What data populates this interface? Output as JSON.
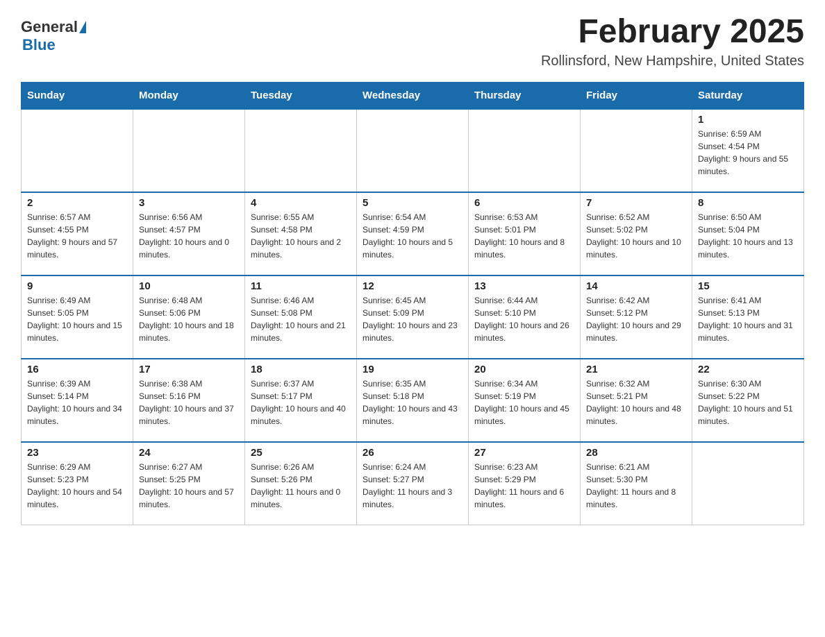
{
  "logo": {
    "general": "General",
    "blue": "Blue"
  },
  "title": "February 2025",
  "location": "Rollinsford, New Hampshire, United States",
  "days_of_week": [
    "Sunday",
    "Monday",
    "Tuesday",
    "Wednesday",
    "Thursday",
    "Friday",
    "Saturday"
  ],
  "weeks": [
    [
      {
        "day": "",
        "info": ""
      },
      {
        "day": "",
        "info": ""
      },
      {
        "day": "",
        "info": ""
      },
      {
        "day": "",
        "info": ""
      },
      {
        "day": "",
        "info": ""
      },
      {
        "day": "",
        "info": ""
      },
      {
        "day": "1",
        "info": "Sunrise: 6:59 AM\nSunset: 4:54 PM\nDaylight: 9 hours and 55 minutes."
      }
    ],
    [
      {
        "day": "2",
        "info": "Sunrise: 6:57 AM\nSunset: 4:55 PM\nDaylight: 9 hours and 57 minutes."
      },
      {
        "day": "3",
        "info": "Sunrise: 6:56 AM\nSunset: 4:57 PM\nDaylight: 10 hours and 0 minutes."
      },
      {
        "day": "4",
        "info": "Sunrise: 6:55 AM\nSunset: 4:58 PM\nDaylight: 10 hours and 2 minutes."
      },
      {
        "day": "5",
        "info": "Sunrise: 6:54 AM\nSunset: 4:59 PM\nDaylight: 10 hours and 5 minutes."
      },
      {
        "day": "6",
        "info": "Sunrise: 6:53 AM\nSunset: 5:01 PM\nDaylight: 10 hours and 8 minutes."
      },
      {
        "day": "7",
        "info": "Sunrise: 6:52 AM\nSunset: 5:02 PM\nDaylight: 10 hours and 10 minutes."
      },
      {
        "day": "8",
        "info": "Sunrise: 6:50 AM\nSunset: 5:04 PM\nDaylight: 10 hours and 13 minutes."
      }
    ],
    [
      {
        "day": "9",
        "info": "Sunrise: 6:49 AM\nSunset: 5:05 PM\nDaylight: 10 hours and 15 minutes."
      },
      {
        "day": "10",
        "info": "Sunrise: 6:48 AM\nSunset: 5:06 PM\nDaylight: 10 hours and 18 minutes."
      },
      {
        "day": "11",
        "info": "Sunrise: 6:46 AM\nSunset: 5:08 PM\nDaylight: 10 hours and 21 minutes."
      },
      {
        "day": "12",
        "info": "Sunrise: 6:45 AM\nSunset: 5:09 PM\nDaylight: 10 hours and 23 minutes."
      },
      {
        "day": "13",
        "info": "Sunrise: 6:44 AM\nSunset: 5:10 PM\nDaylight: 10 hours and 26 minutes."
      },
      {
        "day": "14",
        "info": "Sunrise: 6:42 AM\nSunset: 5:12 PM\nDaylight: 10 hours and 29 minutes."
      },
      {
        "day": "15",
        "info": "Sunrise: 6:41 AM\nSunset: 5:13 PM\nDaylight: 10 hours and 31 minutes."
      }
    ],
    [
      {
        "day": "16",
        "info": "Sunrise: 6:39 AM\nSunset: 5:14 PM\nDaylight: 10 hours and 34 minutes."
      },
      {
        "day": "17",
        "info": "Sunrise: 6:38 AM\nSunset: 5:16 PM\nDaylight: 10 hours and 37 minutes."
      },
      {
        "day": "18",
        "info": "Sunrise: 6:37 AM\nSunset: 5:17 PM\nDaylight: 10 hours and 40 minutes."
      },
      {
        "day": "19",
        "info": "Sunrise: 6:35 AM\nSunset: 5:18 PM\nDaylight: 10 hours and 43 minutes."
      },
      {
        "day": "20",
        "info": "Sunrise: 6:34 AM\nSunset: 5:19 PM\nDaylight: 10 hours and 45 minutes."
      },
      {
        "day": "21",
        "info": "Sunrise: 6:32 AM\nSunset: 5:21 PM\nDaylight: 10 hours and 48 minutes."
      },
      {
        "day": "22",
        "info": "Sunrise: 6:30 AM\nSunset: 5:22 PM\nDaylight: 10 hours and 51 minutes."
      }
    ],
    [
      {
        "day": "23",
        "info": "Sunrise: 6:29 AM\nSunset: 5:23 PM\nDaylight: 10 hours and 54 minutes."
      },
      {
        "day": "24",
        "info": "Sunrise: 6:27 AM\nSunset: 5:25 PM\nDaylight: 10 hours and 57 minutes."
      },
      {
        "day": "25",
        "info": "Sunrise: 6:26 AM\nSunset: 5:26 PM\nDaylight: 11 hours and 0 minutes."
      },
      {
        "day": "26",
        "info": "Sunrise: 6:24 AM\nSunset: 5:27 PM\nDaylight: 11 hours and 3 minutes."
      },
      {
        "day": "27",
        "info": "Sunrise: 6:23 AM\nSunset: 5:29 PM\nDaylight: 11 hours and 6 minutes."
      },
      {
        "day": "28",
        "info": "Sunrise: 6:21 AM\nSunset: 5:30 PM\nDaylight: 11 hours and 8 minutes."
      },
      {
        "day": "",
        "info": ""
      }
    ]
  ]
}
